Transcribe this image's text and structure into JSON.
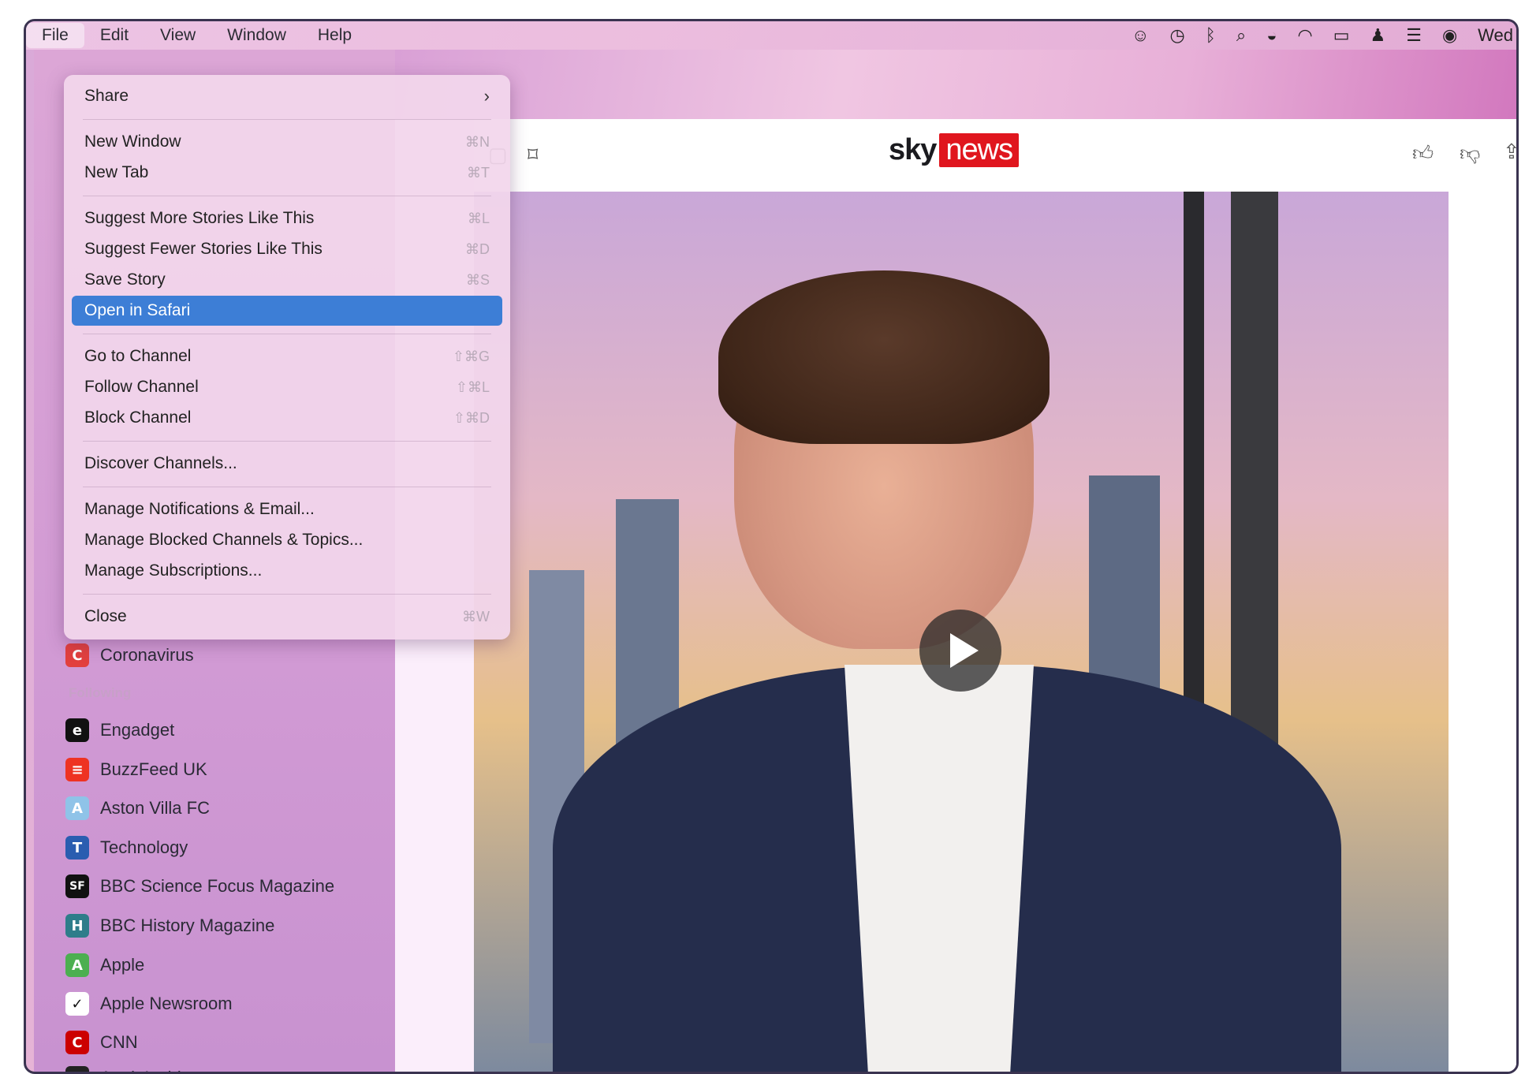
{
  "menubar": {
    "items": [
      "File",
      "Edit",
      "View",
      "Window",
      "Help"
    ],
    "active_index": 0,
    "clock_text": "Wed"
  },
  "file_menu": {
    "items": [
      {
        "label": "Share",
        "shortcut": "›"
      },
      {
        "label": "New Window",
        "shortcut": "⌘N"
      },
      {
        "label": "New Tab",
        "shortcut": "⌘T"
      },
      {
        "label": "Suggest More Stories Like This",
        "shortcut": "⌘L"
      },
      {
        "label": "Suggest Fewer Stories Like This",
        "shortcut": "⌘D"
      },
      {
        "label": "Save Story",
        "shortcut": "⌘S"
      },
      {
        "label": "Open in Safari",
        "shortcut": ""
      },
      {
        "label": "Go to Channel",
        "shortcut": "⇧⌘G"
      },
      {
        "label": "Follow Channel",
        "shortcut": "⇧⌘L"
      },
      {
        "label": "Block Channel",
        "shortcut": "⇧⌘D"
      },
      {
        "label": "Discover Channels...",
        "shortcut": ""
      },
      {
        "label": "Manage Notifications & Email...",
        "shortcut": ""
      },
      {
        "label": "Manage Blocked Channels & Topics...",
        "shortcut": ""
      },
      {
        "label": "Manage Subscriptions...",
        "shortcut": ""
      },
      {
        "label": "Close",
        "shortcut": "⌘W"
      }
    ],
    "highlighted_index": 6
  },
  "sidebar": {
    "top_item": {
      "label": "Coronavirus",
      "icon": "C",
      "color": "#e2403e"
    },
    "following_header": "Following",
    "following": [
      {
        "label": "Engadget",
        "icon": "e",
        "color": "#111111"
      },
      {
        "label": "BuzzFeed UK",
        "icon": "≡",
        "color": "#ee3322"
      },
      {
        "label": "Aston Villa FC",
        "icon": "A",
        "color": "#8fc3e8"
      },
      {
        "label": "Technology",
        "icon": "T",
        "color": "#2a5db0"
      },
      {
        "label": "BBC Science Focus Magazine",
        "icon": "SF",
        "color": "#111111"
      },
      {
        "label": "BBC History Magazine",
        "icon": "H",
        "color": "#2e7d8a"
      },
      {
        "label": "Apple",
        "icon": "A",
        "color": "#4caf50"
      },
      {
        "label": "Apple Newsroom",
        "icon": "✓",
        "color": "#ffffff"
      },
      {
        "label": "CNN",
        "icon": "C",
        "color": "#cc0000"
      },
      {
        "label": "AppleInsider",
        "icon": "a",
        "color": "#222222"
      }
    ]
  },
  "article": {
    "logo_sky": "sky",
    "logo_news": "news"
  },
  "icons": {
    "toolbar": [
      "sidebar-toggle-icon",
      "bookmark-icon",
      "thumbs-up-icon",
      "thumbs-down-icon",
      "share-icon"
    ],
    "status": [
      "user-icon",
      "time-machine-icon",
      "bluetooth-icon",
      "search-icon",
      "vpn-icon",
      "wifi-icon",
      "battery-icon",
      "profile-icon",
      "control-center-icon",
      "siri-icon"
    ],
    "video": "play-icon"
  }
}
